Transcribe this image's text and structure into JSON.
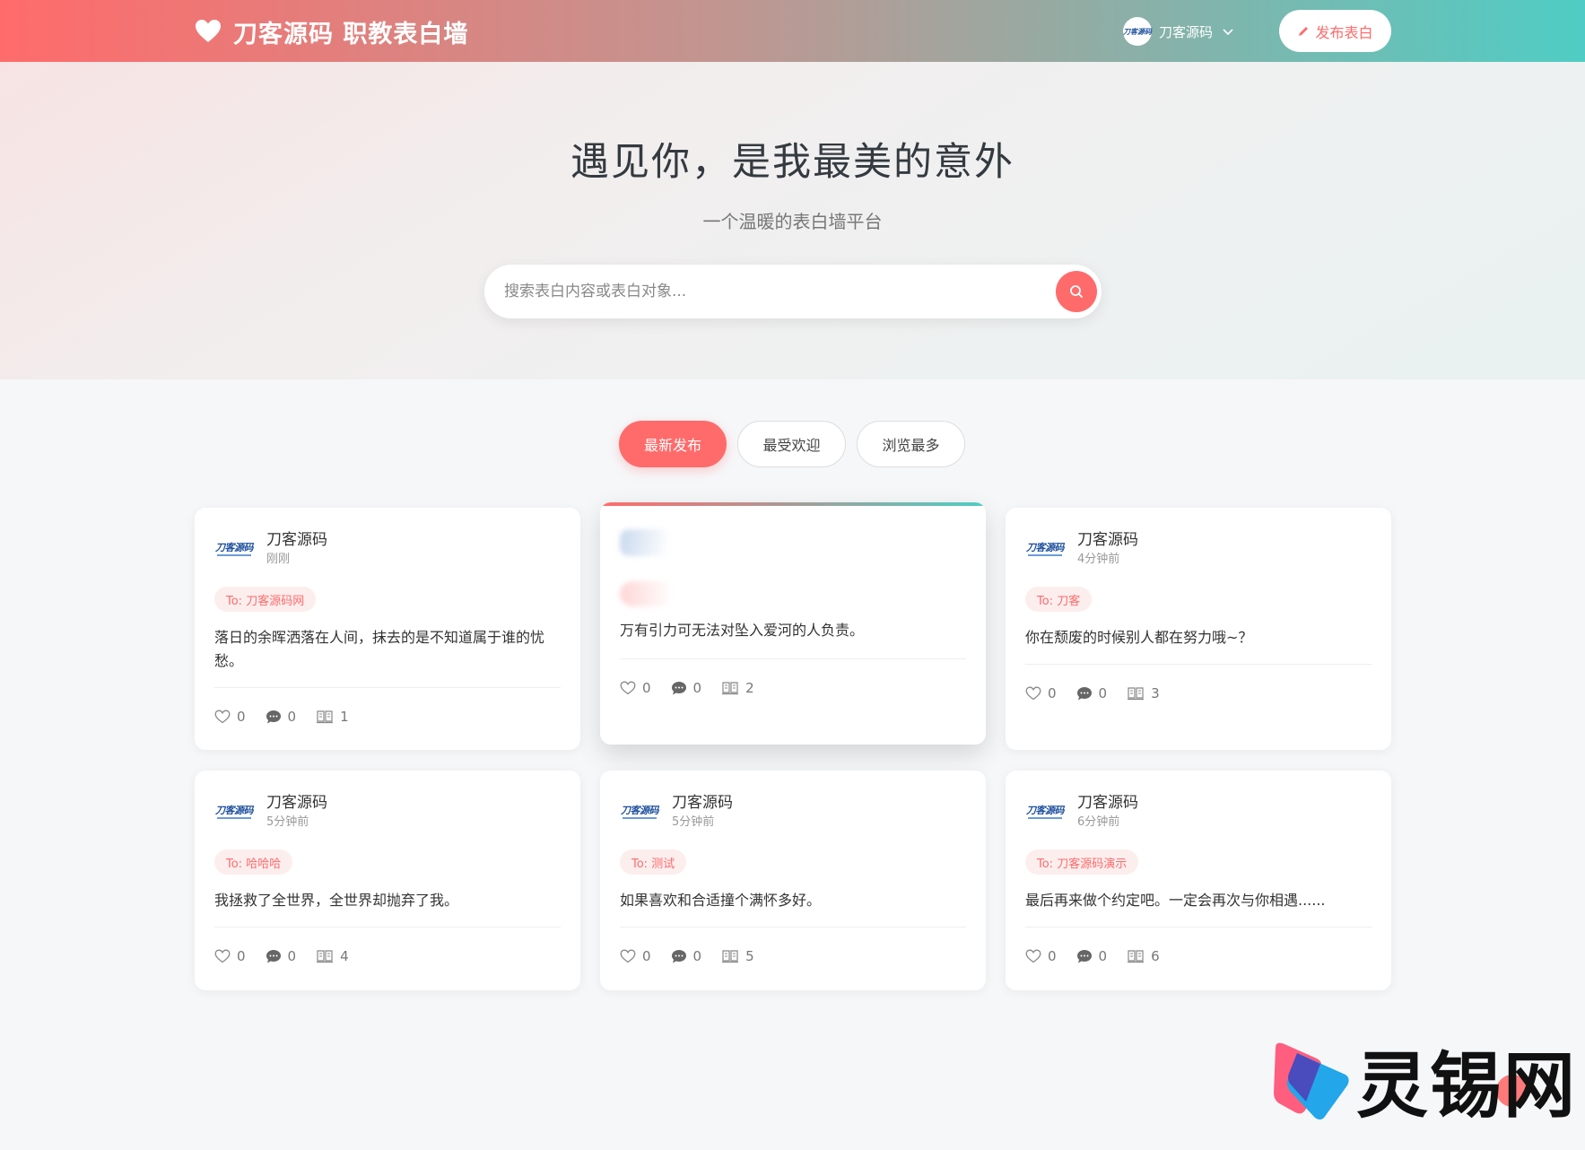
{
  "header": {
    "brand": "刀客源码 职教表白墙",
    "user_name": "刀客源码",
    "user_avatar_text": "刀客源码",
    "publish_label": "发布表白",
    "gradient_start": "#ff6b6b",
    "gradient_end": "#4fcdc4"
  },
  "hero": {
    "title": "遇见你，是我最美的意外",
    "subtitle": "一个温暖的表白墙平台",
    "search_placeholder": "搜索表白内容或表白对象..."
  },
  "tabs": [
    {
      "label": "最新发布",
      "active": true
    },
    {
      "label": "最受欢迎",
      "active": false
    },
    {
      "label": "浏览最多",
      "active": false
    }
  ],
  "cards": [
    {
      "author": "刀客源码",
      "time": "刚刚",
      "to": "To: 刀客源码网",
      "text": "落日的余晖洒落在人间，抹去的是不知道属于谁的忧愁。",
      "likes": "0",
      "comments": "0",
      "views": "1"
    },
    {
      "author": "",
      "time": "",
      "to": "",
      "text": "万有引力可无法对坠入爱河的人负责。",
      "likes": "0",
      "comments": "0",
      "views": "2"
    },
    {
      "author": "刀客源码",
      "time": "4分钟前",
      "to": "To: 刀客",
      "text": "你在颓废的时候别人都在努力哦~？",
      "likes": "0",
      "comments": "0",
      "views": "3"
    },
    {
      "author": "刀客源码",
      "time": "5分钟前",
      "to": "To: 哈哈哈",
      "text": "我拯救了全世界，全世界却抛弃了我。",
      "likes": "0",
      "comments": "0",
      "views": "4"
    },
    {
      "author": "刀客源码",
      "time": "5分钟前",
      "to": "To: 测试",
      "text": "如果喜欢和合适撞个满怀多好。",
      "likes": "0",
      "comments": "0",
      "views": "5"
    },
    {
      "author": "刀客源码",
      "time": "6分钟前",
      "to": "To: 刀客源码演示",
      "text": "最后再来做个约定吧。一定会再次与你相遇......",
      "likes": "0",
      "comments": "0",
      "views": "6"
    }
  ],
  "logo_text": "刀客源码",
  "watermark": "灵锡网",
  "icons": [
    "heart-icon",
    "chevron-down-icon",
    "pencil-icon",
    "search-icon",
    "like-icon",
    "comment-icon",
    "views-icon"
  ]
}
